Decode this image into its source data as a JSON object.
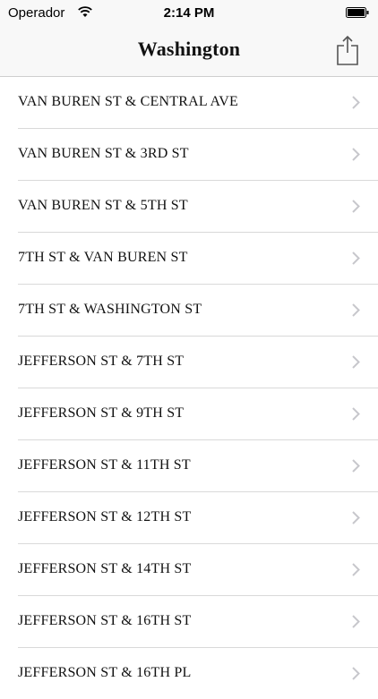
{
  "status_bar": {
    "carrier": "Operador",
    "time": "2:14 PM",
    "wifi_icon": "wifi-icon",
    "battery_icon": "battery-icon"
  },
  "nav": {
    "title": "Washington",
    "share_icon": "share-icon"
  },
  "rows": [
    {
      "label": "VAN BUREN ST & CENTRAL AVE"
    },
    {
      "label": "VAN BUREN ST & 3RD ST"
    },
    {
      "label": "VAN BUREN ST & 5TH ST"
    },
    {
      "label": "7TH ST & VAN BUREN ST"
    },
    {
      "label": "7TH ST & WASHINGTON ST"
    },
    {
      "label": "JEFFERSON ST & 7TH ST"
    },
    {
      "label": "JEFFERSON ST & 9TH ST"
    },
    {
      "label": "JEFFERSON ST & 11TH ST"
    },
    {
      "label": "JEFFERSON ST & 12TH ST"
    },
    {
      "label": "JEFFERSON ST & 14TH ST"
    },
    {
      "label": "JEFFERSON ST & 16TH ST"
    },
    {
      "label": "JEFFERSON ST & 16TH PL"
    }
  ],
  "colors": {
    "chevron": "#c7c7cc",
    "separator": "#d9d9d9",
    "bar_background": "#f8f8f8"
  }
}
